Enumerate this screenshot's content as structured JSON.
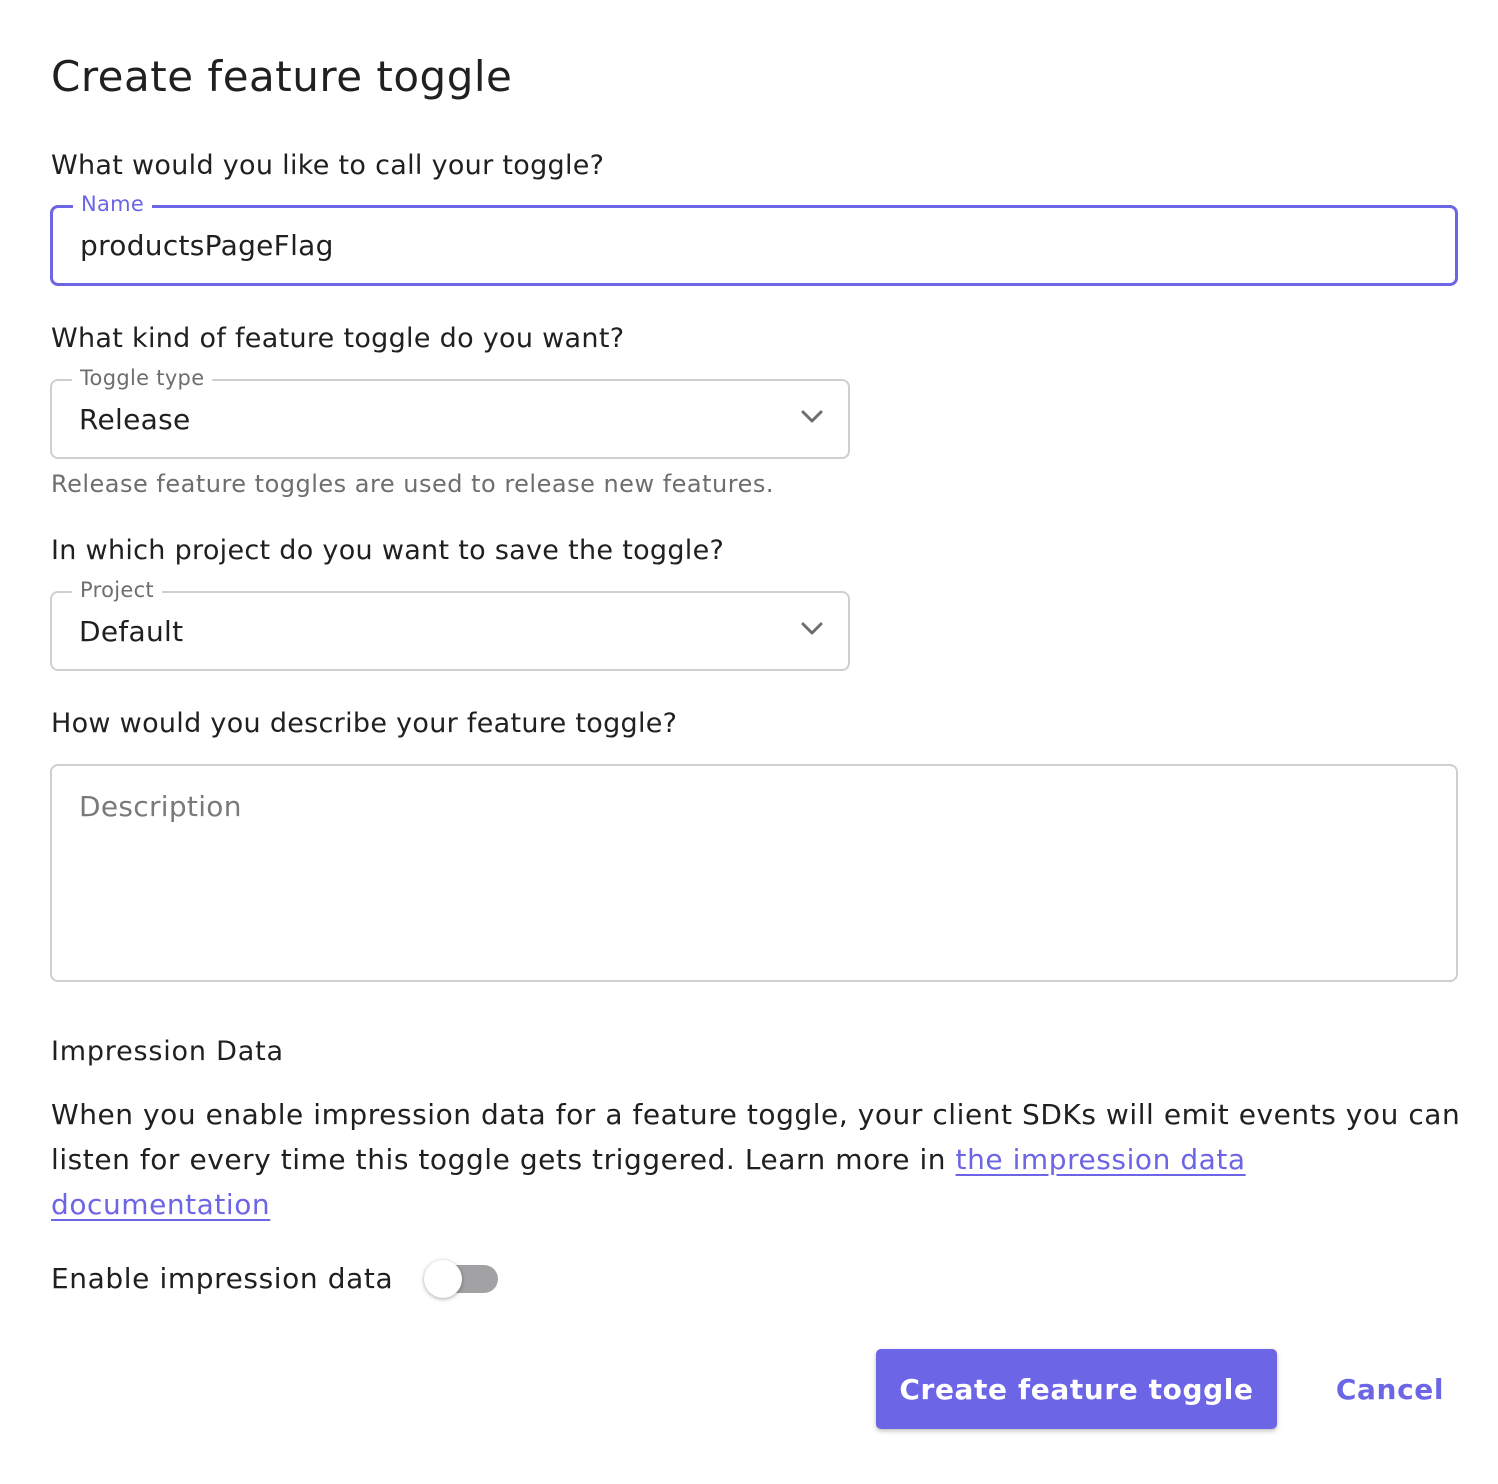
{
  "form": {
    "title": "Create feature toggle",
    "name_question": "What would you like to call your toggle?",
    "name_label": "Name",
    "name_value": "productsPageFlag",
    "type_question": "What kind of feature toggle do you want?",
    "type_label": "Toggle type",
    "type_value": "Release",
    "type_helper": "Release feature toggles are used to release new features.",
    "project_question": "In which project do you want to save the toggle?",
    "project_label": "Project",
    "project_value": "Default",
    "description_question": "How would you describe your feature toggle?",
    "description_placeholder": "Description",
    "description_value": ""
  },
  "impression": {
    "title": "Impression Data",
    "text": "When you enable impression data for a feature toggle, your client SDKs will emit events you can listen for every time this toggle gets triggered. Learn more in",
    "link_text": "the impression data documentation",
    "switch_label": "Enable impression data",
    "enabled": false
  },
  "actions": {
    "create_label": "Create feature toggle",
    "cancel_label": "Cancel"
  },
  "colors": {
    "accent": "#6c65e5",
    "text": "#202021",
    "muted": "#6e6e70",
    "border": "#cfcfd3",
    "switch_off": "#a2a2a5"
  },
  "icons": {
    "dropdown": "chevron-down-icon"
  }
}
